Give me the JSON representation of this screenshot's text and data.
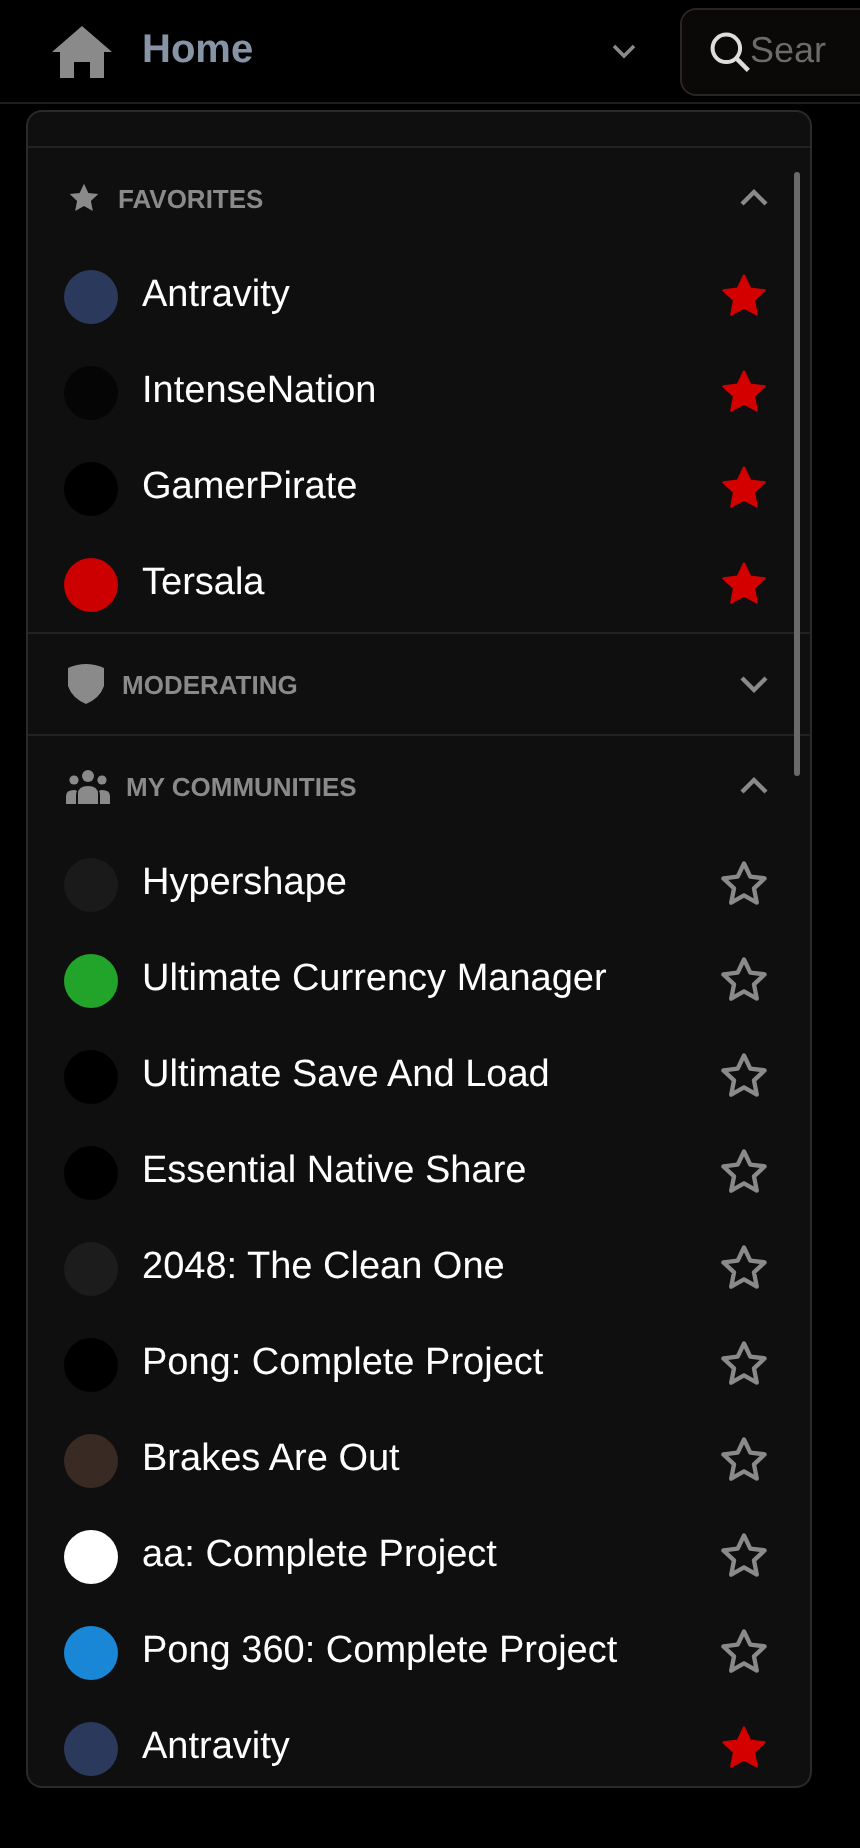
{
  "header": {
    "title": "Home",
    "search": {
      "placeholder": "Sear"
    }
  },
  "sections": [
    {
      "kind": "favorites",
      "title": "FAVORITES",
      "expanded": true,
      "items": [
        {
          "name": "Antravity",
          "favorite": true,
          "color": "#2b3a5c"
        },
        {
          "name": "IntenseNation",
          "favorite": true,
          "color": "#050505"
        },
        {
          "name": "GamerPirate",
          "favorite": true,
          "color": "#000000"
        },
        {
          "name": "Tersala",
          "favorite": true,
          "color": "#cc0000"
        }
      ]
    },
    {
      "kind": "moderating",
      "title": "MODERATING",
      "expanded": false
    },
    {
      "kind": "communities",
      "title": "MY COMMUNITIES",
      "expanded": true,
      "items": [
        {
          "name": "Hypershape",
          "favorite": false,
          "color": "#1a1a1a"
        },
        {
          "name": "Ultimate Currency Manager",
          "favorite": false,
          "color": "#22a32a"
        },
        {
          "name": "Ultimate Save And Load",
          "favorite": false,
          "color": "#000000"
        },
        {
          "name": "Essential Native Share",
          "favorite": false,
          "color": "#000000"
        },
        {
          "name": "2048: The Clean One",
          "favorite": false,
          "color": "#1c1c1c"
        },
        {
          "name": "Pong: Complete Project",
          "favorite": false,
          "color": "#000000"
        },
        {
          "name": "Brakes Are Out",
          "favorite": false,
          "color": "#3a2a24"
        },
        {
          "name": "aa: Complete Project",
          "favorite": false,
          "color": "#ffffff"
        },
        {
          "name": "Pong 360: Complete Project",
          "favorite": false,
          "color": "#1a86d6"
        },
        {
          "name": "Antravity",
          "favorite": true,
          "color": "#2b3a5c"
        }
      ]
    }
  ]
}
